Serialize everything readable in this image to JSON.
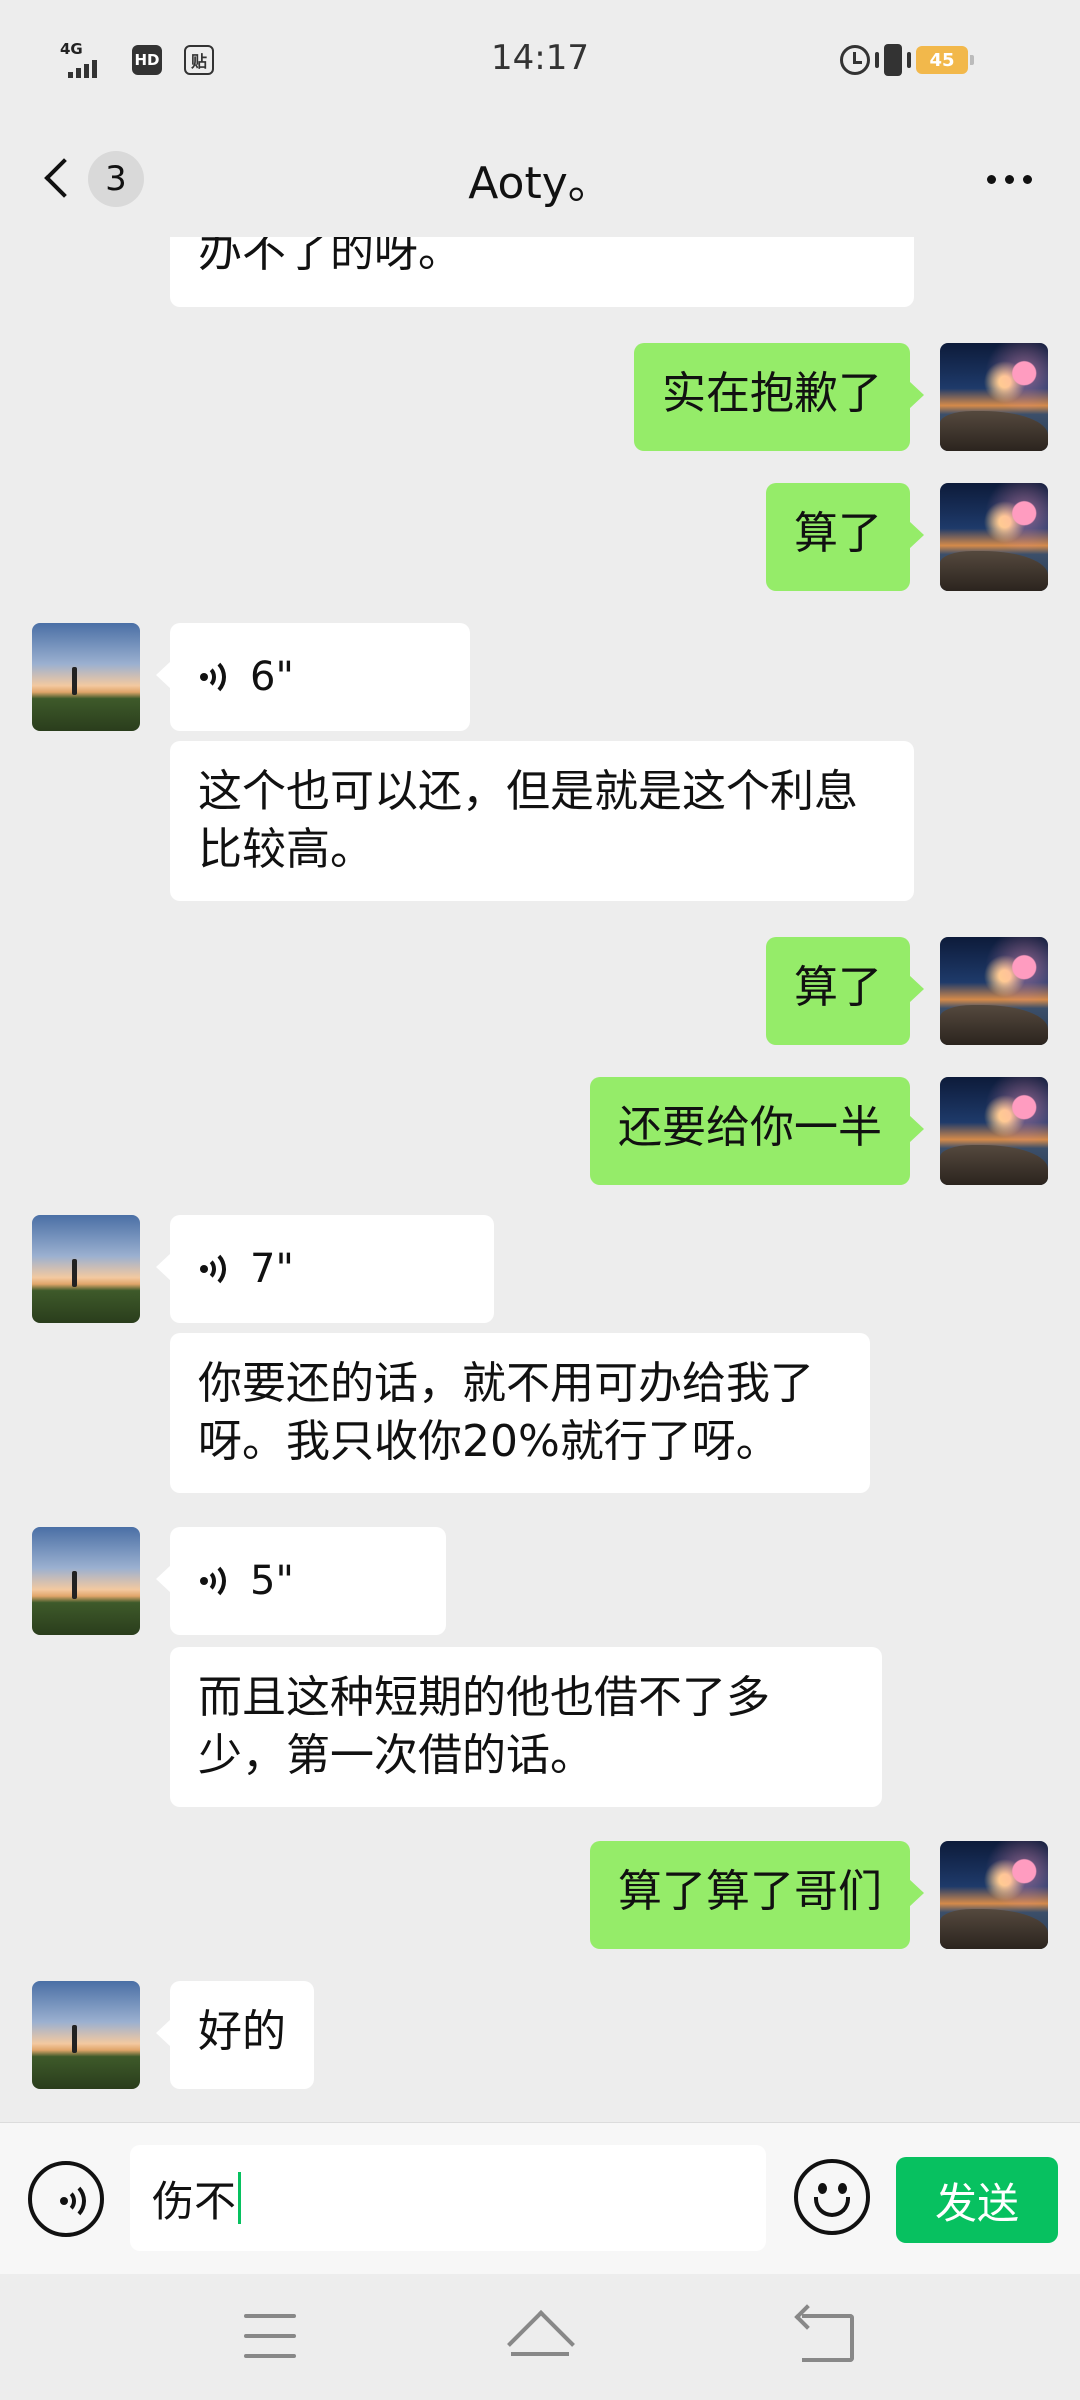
{
  "status_bar": {
    "network": "4G",
    "hd": "HD",
    "tie": "贴",
    "time": "14:17",
    "battery": "45"
  },
  "header": {
    "unread_count": "3",
    "title": "Aoty。"
  },
  "messages": [
    {
      "side": "in",
      "type": "text",
      "text": "办不了的呀。"
    },
    {
      "side": "out",
      "type": "text",
      "text": "实在抱歉了"
    },
    {
      "side": "out",
      "type": "text",
      "text": "算了"
    },
    {
      "side": "in",
      "type": "voice",
      "duration": "6\""
    },
    {
      "side": "in",
      "type": "text",
      "text": "这个也可以还，但是就是这个利息比较高。"
    },
    {
      "side": "out",
      "type": "text",
      "text": "算了"
    },
    {
      "side": "out",
      "type": "text",
      "text": "还要给你一半"
    },
    {
      "side": "in",
      "type": "voice",
      "duration": "7\""
    },
    {
      "side": "in",
      "type": "text",
      "text": "你要还的话，就不用可办给我了呀。我只收你20%就行了呀。"
    },
    {
      "side": "in",
      "type": "voice",
      "duration": "5\""
    },
    {
      "side": "in",
      "type": "text",
      "text": "而且这种短期的他也借不了多少，第一次借的话。"
    },
    {
      "side": "out",
      "type": "text",
      "text": "算了算了哥们"
    },
    {
      "side": "in",
      "type": "text",
      "text": "好的"
    }
  ],
  "input": {
    "value": "伤不",
    "send_label": "发送"
  },
  "colors": {
    "background": "#ededed",
    "outgoing_bubble": "#95ec69",
    "incoming_bubble": "#ffffff",
    "send_button": "#07c160",
    "battery": "#f2b84b"
  },
  "icons": [
    "signal-icon",
    "alarm-icon",
    "vibrate-icon",
    "battery-icon",
    "back-chevron-icon",
    "more-icon",
    "voice-icon",
    "emoji-icon",
    "nav-menu-icon",
    "nav-home-icon",
    "nav-back-icon"
  ]
}
